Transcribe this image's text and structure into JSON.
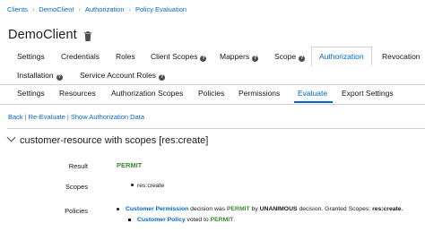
{
  "breadcrumb": [
    "Clients",
    "DemoClient",
    "Authorization",
    "Policy Evaluation"
  ],
  "page_title": "DemoClient",
  "main_tabs_row1": [
    {
      "label": "Settings",
      "help": false
    },
    {
      "label": "Credentials",
      "help": false
    },
    {
      "label": "Roles",
      "help": false
    },
    {
      "label": "Client Scopes",
      "help": true
    },
    {
      "label": "Mappers",
      "help": true
    },
    {
      "label": "Scope",
      "help": true
    },
    {
      "label": "Authorization",
      "help": false,
      "active": true
    },
    {
      "label": "Revocation",
      "help": false
    }
  ],
  "main_tabs_row2": [
    {
      "label": "Installation",
      "help": true
    },
    {
      "label": "Service Account Roles",
      "help": true
    }
  ],
  "sub_tabs": [
    {
      "label": "Settings"
    },
    {
      "label": "Resources"
    },
    {
      "label": "Authorization Scopes"
    },
    {
      "label": "Policies"
    },
    {
      "label": "Permissions"
    },
    {
      "label": "Evaluate",
      "active": true
    },
    {
      "label": "Export Settings"
    }
  ],
  "actions": {
    "back": "Back",
    "reevaluate": "Re-Evaluate",
    "show_data": "Show Authorization Data"
  },
  "section": {
    "title": "customer-resource with scopes [res:create]",
    "result_label": "Result",
    "result_value": "PERMIT",
    "scopes_label": "Scopes",
    "scopes": [
      "res:create"
    ],
    "policies_label": "Policies",
    "policy1": {
      "name": "Customer Permission",
      "text1": "decision was",
      "decision": "PERMIT",
      "text2": "by",
      "strategy": "UNANIMOUS",
      "text3": "decision. Granted Scopes:",
      "granted": "res:create",
      "end": "."
    },
    "policy2": {
      "name": "Customer Policy",
      "text1": "voted to",
      "decision": "PERMIT",
      "end": "."
    }
  },
  "colors": {
    "link": "#0066cc",
    "permit": "#3e8635",
    "text": "#151515"
  },
  "icons": {
    "delete": "trash-icon",
    "help": "question-circle-icon",
    "toggle": "chevron-down-icon"
  }
}
